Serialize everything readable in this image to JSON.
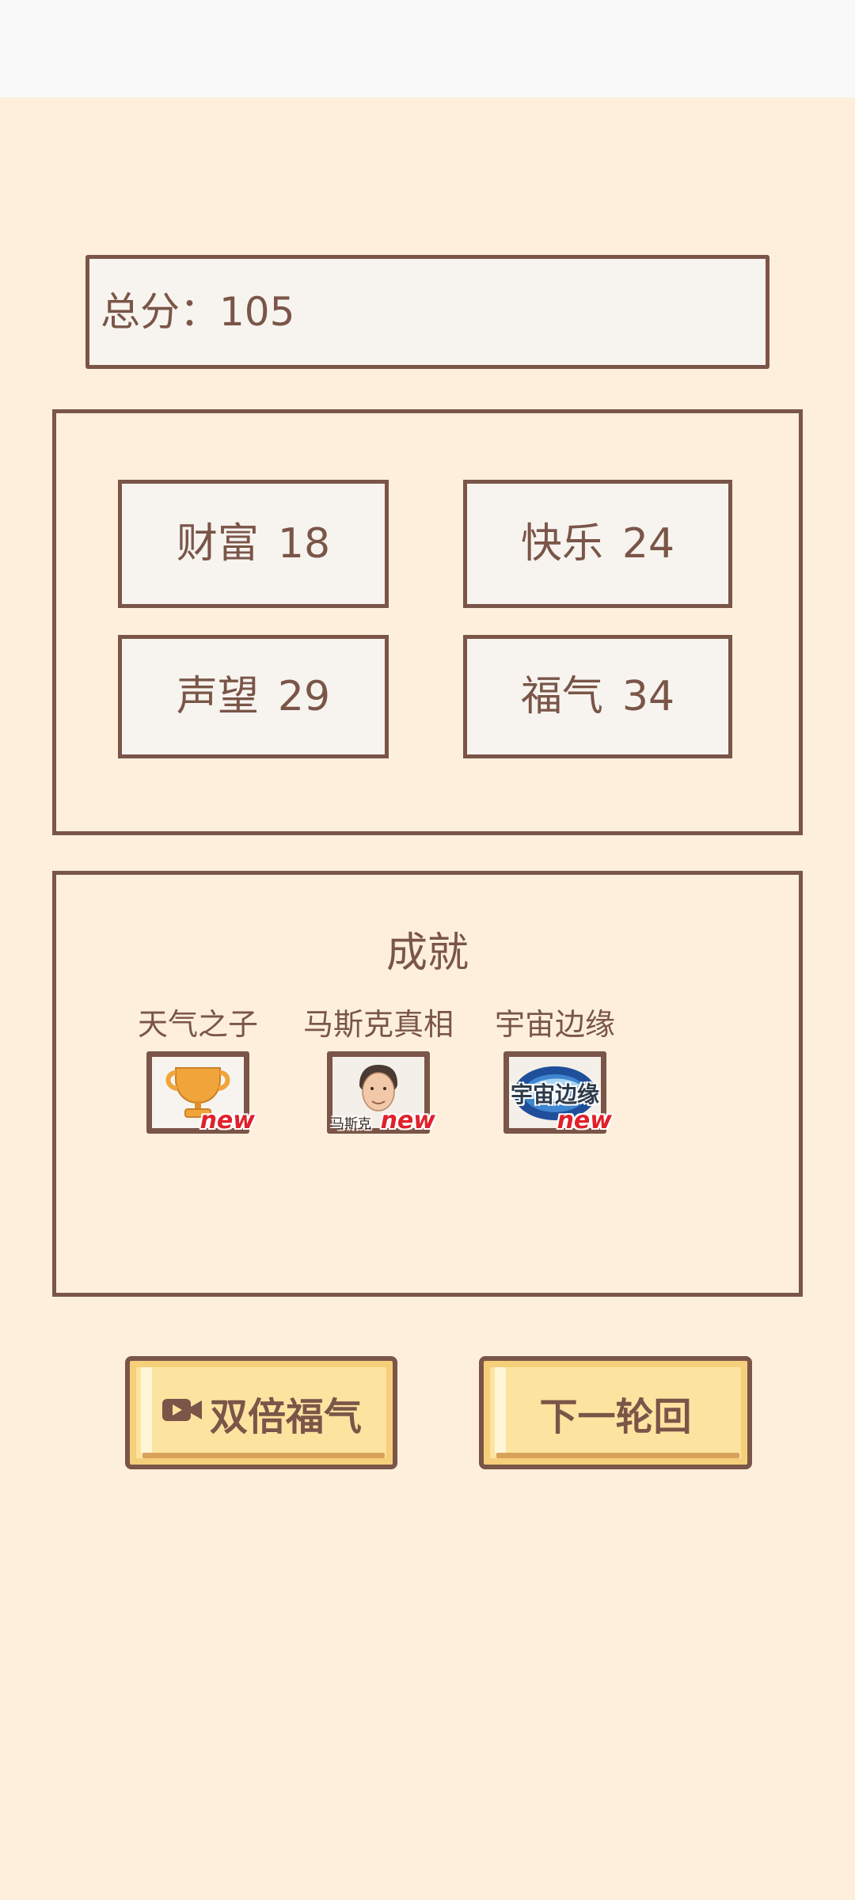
{
  "header": {
    "total_label": "总分：",
    "total_value": "105"
  },
  "stats": [
    {
      "name": "财富",
      "value": "18"
    },
    {
      "name": "快乐",
      "value": "24"
    },
    {
      "name": "声望",
      "value": "29"
    },
    {
      "name": "福气",
      "value": "34"
    }
  ],
  "achievements": {
    "title": "成就",
    "badge": "new",
    "items": [
      {
        "label": "天气之子",
        "icon": "trophy-icon"
      },
      {
        "label": "马斯克真相",
        "icon": "portrait-icon",
        "icon_text": "马斯克"
      },
      {
        "label": "宇宙边缘",
        "icon": "galaxy-icon",
        "icon_text": "宇宙边缘"
      }
    ]
  },
  "buttons": {
    "double_label": "双倍福气",
    "double_icon": "video-camera-icon",
    "next_label": "下一轮回"
  },
  "colors": {
    "background": "#fdefdc",
    "border": "#7a5548",
    "text": "#7a5548",
    "button": "#fde3a0",
    "new_badge": "#e0202a"
  }
}
